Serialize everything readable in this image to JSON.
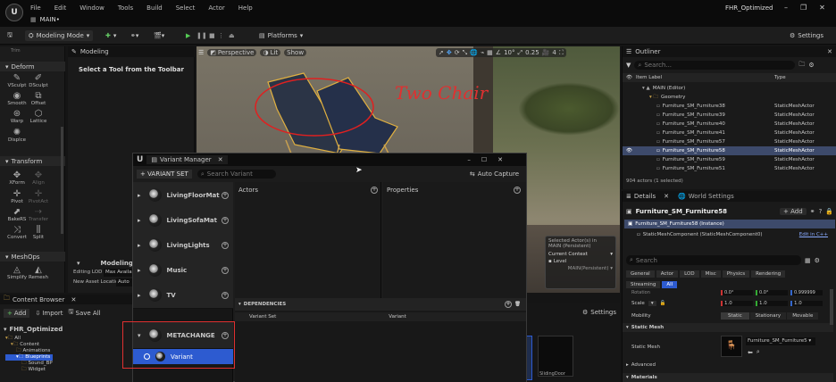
{
  "app": {
    "logo": "U",
    "project_name": "FHR_Optimized",
    "map_tab": "MAIN•",
    "menu": [
      "File",
      "Edit",
      "Window",
      "Tools",
      "Build",
      "Select",
      "Actor",
      "Help"
    ]
  },
  "toolbar": {
    "mode": "Modeling Mode",
    "platforms": "Platforms",
    "settings": "Settings"
  },
  "left_tools": {
    "top_label": "Trim",
    "sections": [
      {
        "name": "Deform"
      },
      {
        "name": "Transform"
      },
      {
        "name": "MeshOps"
      }
    ],
    "deform_tools": [
      "VSculpt",
      "DSculpt",
      "Smooth",
      "Offset",
      "Warp",
      "Lattice",
      "Displce"
    ],
    "transform_tools": [
      "XForm",
      "Align",
      "Pivot",
      "PivotAct",
      "BakeRS",
      "Transfer",
      "Convert",
      "Split"
    ],
    "meshops_tools": [
      "Simplify",
      "Remesh"
    ]
  },
  "modeling_panel": {
    "tab": "Modeling",
    "prompt": "Select a Tool from the Toolbar",
    "section": "Modeling Mod",
    "lod_label": "Editing LOD",
    "lod_value": "Max Availa",
    "asset_label": "New Asset Location",
    "asset_value": "Auto"
  },
  "viewport": {
    "perspective": "Perspective",
    "lit": "Lit",
    "show": "Show",
    "fov": "10°",
    "speed": "0.25",
    "scale": "4",
    "annotation": "Two Chair",
    "context": {
      "selected": "Selected Actor(s) in",
      "selected2": "MAIN (Persistent)",
      "current": "Current Context",
      "level": "Level",
      "level_value": "MAIN(Persistent)"
    }
  },
  "outliner": {
    "tab": "Outliner",
    "search": "Search...",
    "col_label": "Item Label",
    "col_type": "Type",
    "rows": [
      {
        "label": "MAIN (Editor)",
        "type": ""
      },
      {
        "label": "Geometry",
        "type": ""
      },
      {
        "label": "Furniture_SM_Furniture38",
        "type": "StaticMeshActor"
      },
      {
        "label": "Furniture_SM_Furniture39",
        "type": "StaticMeshActor"
      },
      {
        "label": "Furniture_SM_Furniture40",
        "type": "StaticMeshActor"
      },
      {
        "label": "Furniture_SM_Furniture41",
        "type": "StaticMeshActor"
      },
      {
        "label": "Furniture_SM_Furniture57",
        "type": "StaticMeshActor"
      },
      {
        "label": "Furniture_SM_Furniture58",
        "type": "StaticMeshActor"
      },
      {
        "label": "Furniture_SM_Furniture59",
        "type": "StaticMeshActor"
      },
      {
        "label": "Furniture_SM_Furniture51",
        "type": "StaticMeshActor"
      }
    ],
    "status": "904 actors (1 selected)"
  },
  "details": {
    "tab": "Details",
    "tab2": "World Settings",
    "name": "Furniture_SM_Furniture58",
    "add": "+ Add",
    "instance": "Furniture_SM_Furniture58 (Instance)",
    "component": "StaticMeshComponent (StaticMeshComponent0)",
    "edit_cpp": "Edit in C++",
    "search": "Search",
    "filters": [
      "General",
      "Actor",
      "LOD",
      "Misc",
      "Physics",
      "Rendering",
      "Streaming",
      "All"
    ],
    "rotation_label": "Rotation",
    "rotation": [
      "0.0°",
      "0.0°",
      "0.999999"
    ],
    "scale_label": "Scale",
    "scale": [
      "1.0",
      "1.0",
      "1.0"
    ],
    "mobility_label": "Mobility",
    "mobility": [
      "Static",
      "Stationary",
      "Movable"
    ],
    "static_mesh_header": "Static Mesh",
    "static_mesh_label": "Static Mesh",
    "static_mesh_value": "Furniture_SM_Furniture5",
    "advanced": "Advanced",
    "materials": "Materials"
  },
  "content_browser": {
    "tab": "Content Browser",
    "add": "Add",
    "import": "Import",
    "save_all": "Save All",
    "root": "FHR_Optimized",
    "tree": [
      "All",
      "Content",
      "Animations",
      "Blueprints",
      "Sound_BP",
      "Widget"
    ],
    "settings": "Settings",
    "thumb_label": "SlidingDoor"
  },
  "variant_manager": {
    "title": "Variant Manager",
    "add_set": "+ VARIANT SET",
    "search": "Search Variant",
    "auto_capture": "Auto Capture",
    "actors": "Actors",
    "properties": "Properties",
    "dependencies": "DEPENDENCIES",
    "col_variant_set": "Variant Set",
    "col_variant": "Variant",
    "sets": [
      "LivingFloorMat",
      "LivingSofaMat",
      "LivingLights",
      "Music",
      "TV",
      "METACHANGE"
    ],
    "selected_variant": "Variant"
  }
}
